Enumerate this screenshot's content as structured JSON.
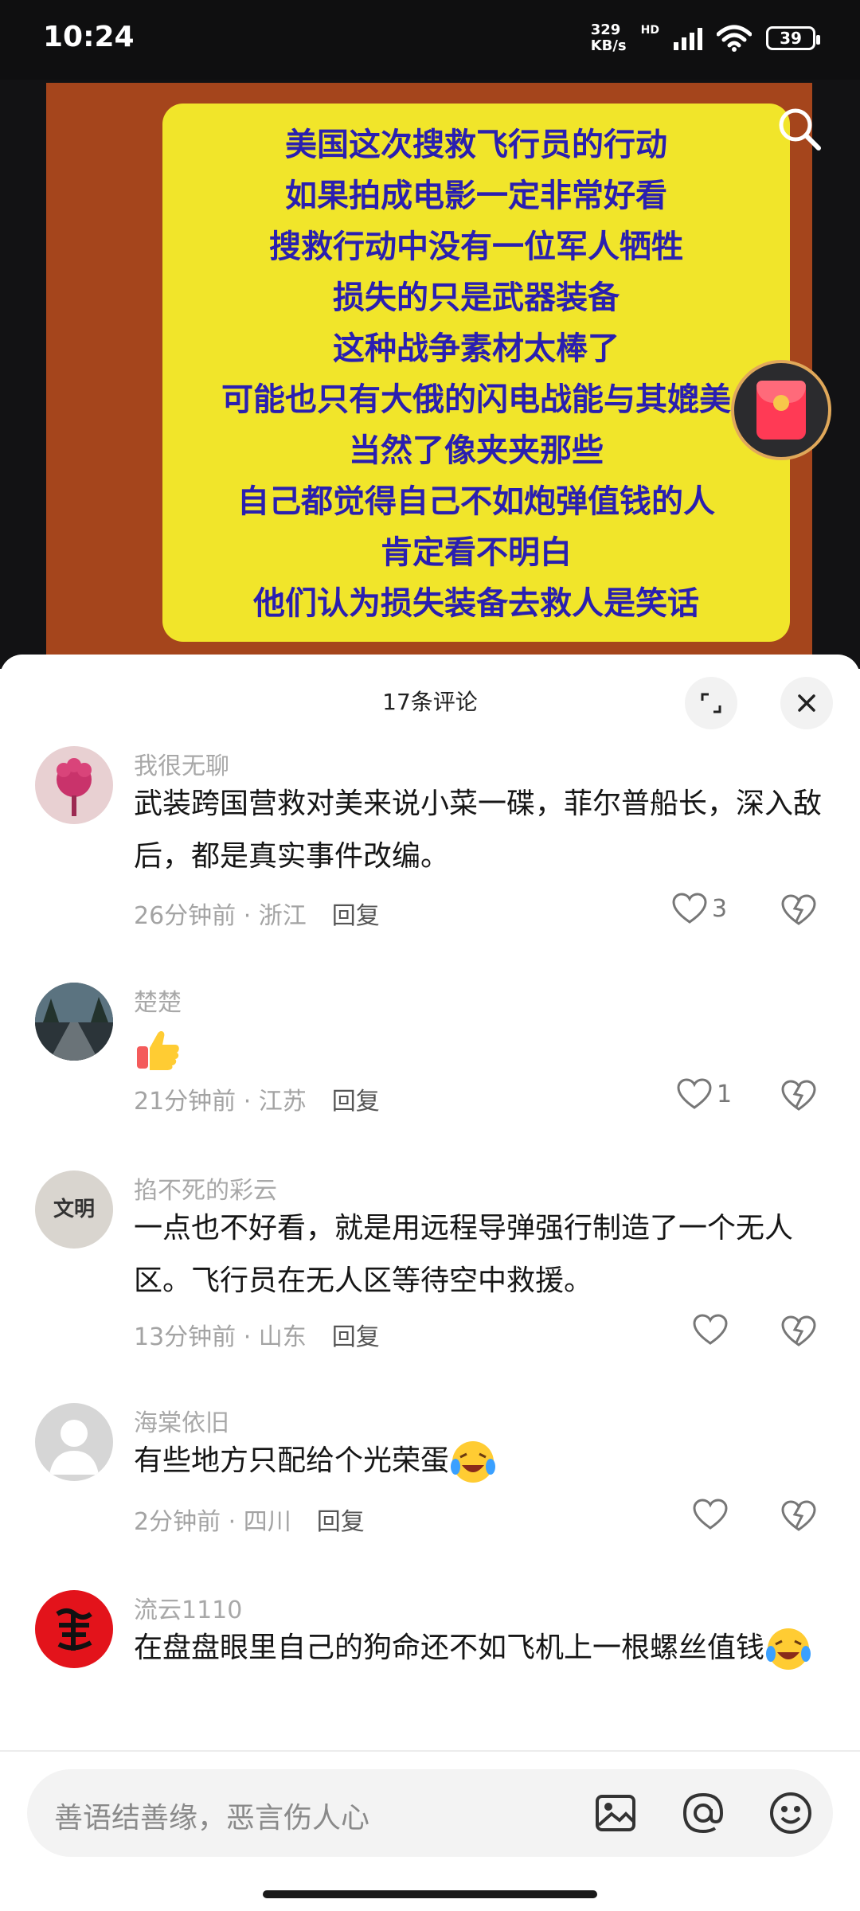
{
  "status_bar": {
    "time": "10:24",
    "net_speed_value": "329",
    "net_speed_unit": "KB/s",
    "hd": "HD",
    "battery": "39",
    "icons": [
      "signal-icon",
      "wifi-icon",
      "battery-icon"
    ]
  },
  "video": {
    "poster_lines": [
      "美国这次搜救飞行员的行动",
      "如果拍成电影一定非常好看",
      "搜救行动中没有一位军人牺牲",
      "损失的只是武器装备",
      "这种战争素材太棒了",
      "可能也只有大俄的闪电战能与其媲美",
      "当然了像夹夹那些",
      "自己都觉得自己不如炮弹值钱的人",
      "肯定看不明白",
      "他们认为损失装备去救人是笑话"
    ],
    "colors": {
      "card": "#f1e52a",
      "text": "#2a1fb0",
      "border": "#a5451c"
    }
  },
  "comments_sheet": {
    "title": "17条评论",
    "reply_label": "回复",
    "comments": [
      {
        "user": "我很无聊",
        "text": "武装跨国营救对美来说小菜一碟，菲尔普船长，深入敌后，都是真实事件改编。",
        "time": "26分钟前",
        "location": "浙江",
        "likes": "3"
      },
      {
        "user": "楚楚",
        "text": "",
        "time": "21分钟前",
        "location": "江苏",
        "likes": "1",
        "emoji": "thumbs-up"
      },
      {
        "user": "掐不死的彩云",
        "text": "一点也不好看，就是用远程导弹强行制造了一个无人区。飞行员在无人区等待空中救援。",
        "time": "13分钟前",
        "location": "山东",
        "likes": "",
        "avatar_text": "文明"
      },
      {
        "user": "海棠依旧",
        "text": "有些地方只配给个光荣蛋",
        "time": "2分钟前",
        "location": "四川",
        "likes": "",
        "emoji": "crying-laughing"
      },
      {
        "user": "流云1110",
        "text": "在盘盘眼里自己的狗命还不如飞机上一根螺丝值钱",
        "emoji": "crying-laughing"
      }
    ]
  },
  "input": {
    "placeholder": "善语结善缘，恶言伤人心"
  }
}
